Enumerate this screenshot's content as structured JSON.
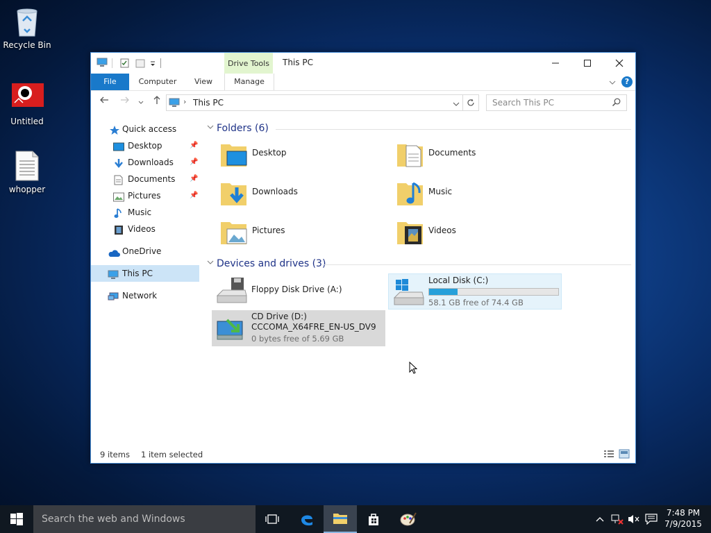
{
  "desktop": {
    "icons": [
      {
        "label": "Recycle Bin",
        "icon": "recycle-bin-icon"
      },
      {
        "label": "Untitled",
        "icon": "image-file-icon"
      },
      {
        "label": "whopper",
        "icon": "text-document-icon"
      }
    ]
  },
  "window": {
    "title": "This PC",
    "context_tab_group": "Drive Tools",
    "tabs": [
      "File",
      "Computer",
      "View",
      "Manage"
    ],
    "address": "This PC",
    "search_placeholder": "Search This PC",
    "help_glyph": "?"
  },
  "nav": {
    "quick_access": "Quick access",
    "items": [
      {
        "label": "Desktop",
        "pinned": true,
        "icon": "desktop-icon"
      },
      {
        "label": "Downloads",
        "pinned": true,
        "icon": "downloads-icon"
      },
      {
        "label": "Documents",
        "pinned": true,
        "icon": "documents-icon"
      },
      {
        "label": "Pictures",
        "pinned": true,
        "icon": "pictures-icon"
      },
      {
        "label": "Music",
        "pinned": false,
        "icon": "music-icon"
      },
      {
        "label": "Videos",
        "pinned": false,
        "icon": "videos-icon"
      }
    ],
    "onedrive": "OneDrive",
    "this_pc": "This PC",
    "network": "Network"
  },
  "content": {
    "folders_header": "Folders (6)",
    "folders": [
      "Desktop",
      "Documents",
      "Downloads",
      "Music",
      "Pictures",
      "Videos"
    ],
    "drives_header": "Devices and drives (3)",
    "drives": [
      {
        "name": "Floppy Disk Drive (A:)"
      },
      {
        "name": "Local Disk (C:)",
        "free": "58.1 GB free of 74.4 GB",
        "used_fraction": 0.22
      },
      {
        "name": "CD Drive (D:)",
        "label": "CCCOMA_X64FRE_EN-US_DV9",
        "free": "0 bytes free of 5.69 GB"
      }
    ]
  },
  "status": {
    "items": "9 items",
    "selected": "1 item selected"
  },
  "taskbar": {
    "search_placeholder": "Search the web and Windows",
    "time": "7:48 PM",
    "date": "7/9/2015"
  },
  "colors": {
    "accent": "#1979ca",
    "selection": "#cce4f7",
    "drive_tools": "#e2f5cf",
    "progress": "#26a0da"
  }
}
